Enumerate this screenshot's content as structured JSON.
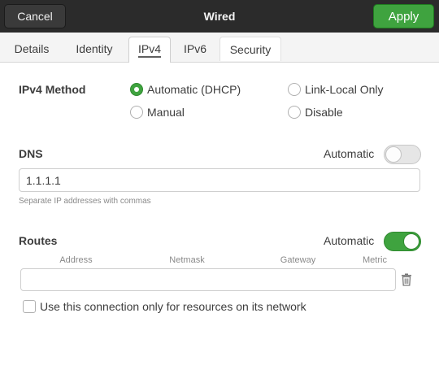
{
  "header": {
    "title": "Wired",
    "cancel_label": "Cancel",
    "apply_label": "Apply",
    "apply_color": "#3fa33f"
  },
  "tabs": [
    {
      "label": "Details"
    },
    {
      "label": "Identity"
    },
    {
      "label": "IPv4",
      "active": true
    },
    {
      "label": "IPv6"
    },
    {
      "label": "Security"
    }
  ],
  "ipv4": {
    "method_label": "IPv4 Method",
    "options": [
      {
        "label": "Automatic (DHCP)",
        "selected": true
      },
      {
        "label": "Link-Local Only",
        "selected": false
      },
      {
        "label": "Manual",
        "selected": false
      },
      {
        "label": "Disable",
        "selected": false
      }
    ]
  },
  "dns": {
    "label": "DNS",
    "automatic_label": "Automatic",
    "automatic_on": false,
    "value": "1.1.1.1",
    "hint": "Separate IP addresses with commas"
  },
  "routes": {
    "label": "Routes",
    "automatic_label": "Automatic",
    "automatic_on": true,
    "columns": [
      "Address",
      "Netmask",
      "Gateway",
      "Metric"
    ],
    "trash_icon": "trash-icon"
  },
  "only_network": {
    "label": "Use this connection only for resources on its network",
    "checked": false
  }
}
